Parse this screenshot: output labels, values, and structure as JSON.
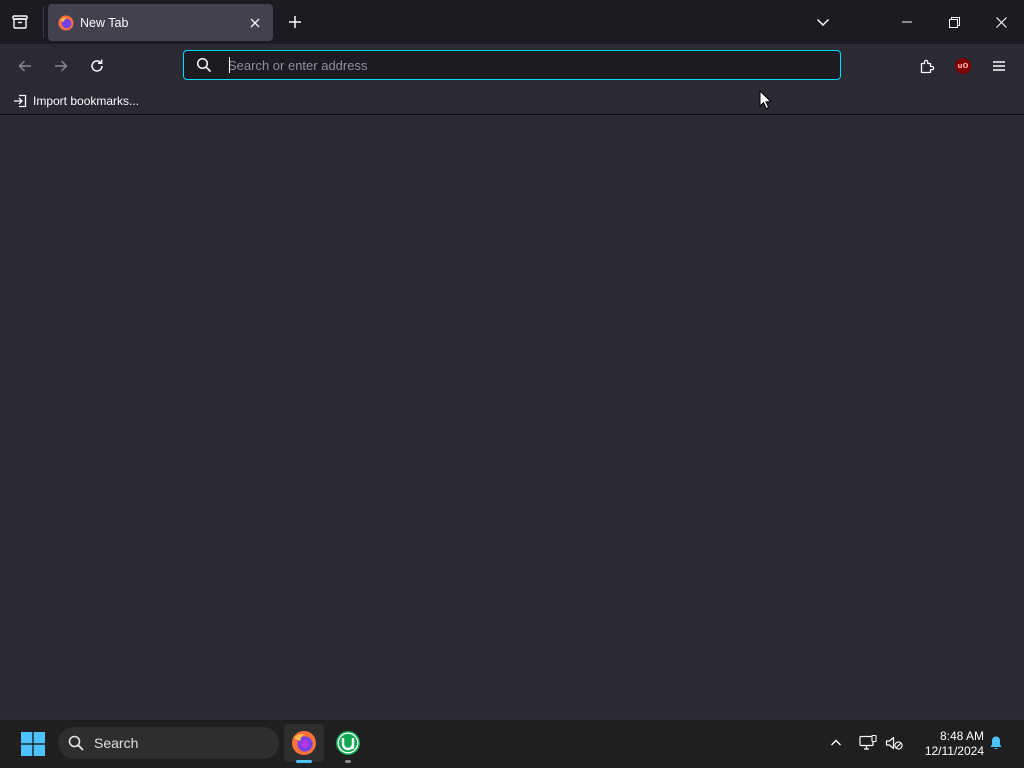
{
  "browser": {
    "tabs": [
      {
        "title": "New Tab",
        "active": true,
        "favicon": "firefox-icon"
      }
    ],
    "urlbar": {
      "placeholder": "Search or enter address",
      "value": ""
    },
    "bookmarks_toolbar": {
      "import_label": "Import bookmarks..."
    }
  },
  "taskbar": {
    "search_label": "Search",
    "pinned_apps": [
      "firefox-icon",
      "utorrent-icon"
    ],
    "clock": {
      "time": "8:48 AM",
      "date": "12/11/2024"
    }
  },
  "colors": {
    "tab_strip": "#1c1b22",
    "toolbar": "#2b2a33",
    "active_tab": "#42414d",
    "urlbar_focus_ring": "#00ddff",
    "taskbar": "#1f1f1f",
    "windows_accent": "#4cc2ff"
  }
}
